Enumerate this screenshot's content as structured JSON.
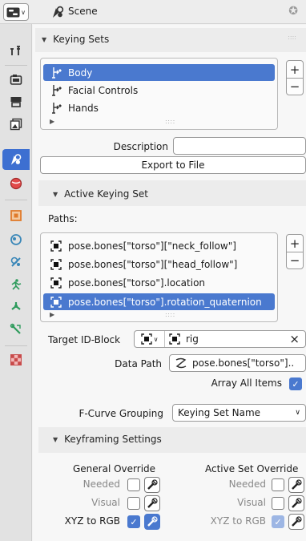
{
  "header": {
    "editor_type_icon": "properties-editor-icon",
    "title": "Scene",
    "pin_icon": "pin-icon"
  },
  "tabs": [
    {
      "name": "tool",
      "icon": "tool-icon",
      "active": false
    },
    {
      "name": "render",
      "icon": "render-icon",
      "active": false
    },
    {
      "name": "output",
      "icon": "output-icon",
      "active": false
    },
    {
      "name": "view-layer",
      "icon": "view-layer-icon",
      "active": false
    },
    {
      "name": "scene",
      "icon": "scene-icon",
      "active": true
    },
    {
      "name": "world",
      "icon": "world-icon",
      "active": false
    },
    {
      "name": "object",
      "icon": "object-icon",
      "active": false
    },
    {
      "name": "modifiers",
      "icon": "modifier-icon",
      "active": false
    },
    {
      "name": "particles",
      "icon": "particles-icon",
      "active": false
    },
    {
      "name": "physics",
      "icon": "physics-icon",
      "active": false
    },
    {
      "name": "constraints",
      "icon": "constraint-icon",
      "active": false
    },
    {
      "name": "data",
      "icon": "armature-data-icon",
      "active": false
    },
    {
      "name": "texture",
      "icon": "texture-icon",
      "active": false
    }
  ],
  "keying_sets": {
    "title": "Keying Sets",
    "items": [
      {
        "label": "Body",
        "selected": true
      },
      {
        "label": "Facial Controls",
        "selected": false
      },
      {
        "label": "Hands",
        "selected": false
      }
    ],
    "add_label": "+",
    "remove_label": "−",
    "grip": "::::",
    "description_label": "Description",
    "description_value": "",
    "export_label": "Export to File"
  },
  "active_keying_set": {
    "title": "Active Keying Set",
    "paths_label": "Paths:",
    "paths": [
      {
        "label": "pose.bones[\"torso\"][\"neck_follow\"]",
        "selected": false
      },
      {
        "label": "pose.bones[\"torso\"][\"head_follow\"]",
        "selected": false
      },
      {
        "label": "pose.bones[\"torso\"].location",
        "selected": false
      },
      {
        "label": "pose.bones[\"torso\"].rotation_quaternion",
        "selected": true
      }
    ],
    "add_label": "+",
    "remove_label": "−",
    "grip": "::::",
    "target_label": "Target ID-Block",
    "target_value": "rig",
    "clear_label": "×",
    "data_path_label": "Data Path",
    "data_path_value": "pose.bones[\"torso\"]..",
    "array_all_label": "Array All Items",
    "array_all_checked": true,
    "fcurve_label": "F-Curve Grouping",
    "fcurve_value": "Keying Set Name"
  },
  "keyframing_settings": {
    "title": "Keyframing Settings",
    "general_title": "General Override",
    "active_title": "Active Set Override",
    "general": [
      {
        "label": "Needed",
        "checked": false,
        "key_on": false,
        "muted": true
      },
      {
        "label": "Visual",
        "checked": false,
        "key_on": false,
        "muted": true
      },
      {
        "label": "XYZ to RGB",
        "checked": true,
        "key_on": true,
        "muted": false
      }
    ],
    "active": [
      {
        "label": "Needed",
        "checked": false,
        "key_on": false,
        "muted": true
      },
      {
        "label": "Visual",
        "checked": false,
        "key_on": false,
        "muted": true
      },
      {
        "label": "XYZ to RGB",
        "checked": true,
        "key_on": false,
        "muted": true
      }
    ]
  },
  "colors": {
    "accent": "#4a79cf",
    "tab_active": "#3d6fd1",
    "panel_bg": "#f7f7f7",
    "header_bg": "#ededed"
  }
}
